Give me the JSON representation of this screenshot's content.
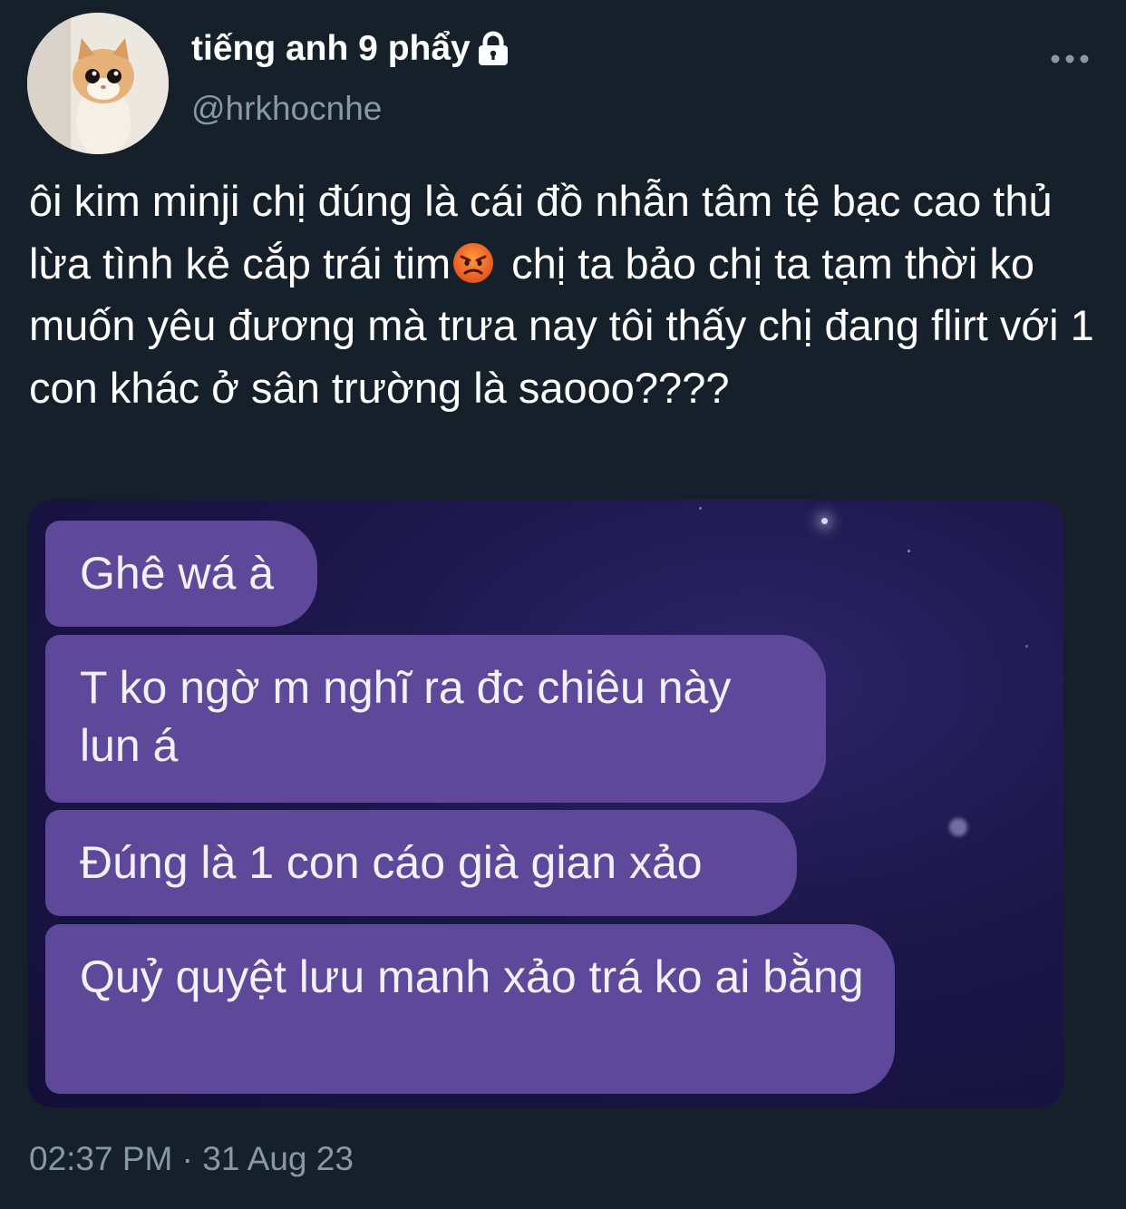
{
  "user": {
    "display_name": "tiếng anh 9 phẩy",
    "handle": "@hrkhocnhe",
    "avatar_icon": "kitten-avatar",
    "protected_icon": "lock-icon"
  },
  "menu": {
    "icon": "more-horizontal-icon"
  },
  "tweet": {
    "text_before_emoji": "ôi kim minji chị đúng là cái đồ nhẫn tâm tệ bạc cao thủ lừa tình kẻ cắp trái tim",
    "emoji": "angry-face-emoji",
    "text_after_emoji": " chị ta bảo chị ta tạm thời ko muốn yêu đương mà trưa nay tôi thấy chị đang flirt với 1 con khác ở sân trường là saooo????"
  },
  "media": {
    "messages": [
      "Ghê wá à",
      "T ko ngờ m nghĩ ra đc chiêu này lun á",
      "Đúng là 1 con cáo già gian xảo",
      "Quỷ quyệt lưu manh xảo trá ko ai bằng"
    ],
    "bubble_color": "#5e489a",
    "background_color": "#1c1649"
  },
  "timestamp": "02:37 PM · 31 Aug 23",
  "colors": {
    "background": "#15202b",
    "text_primary": "#ffffff",
    "text_secondary": "#8899a6"
  }
}
